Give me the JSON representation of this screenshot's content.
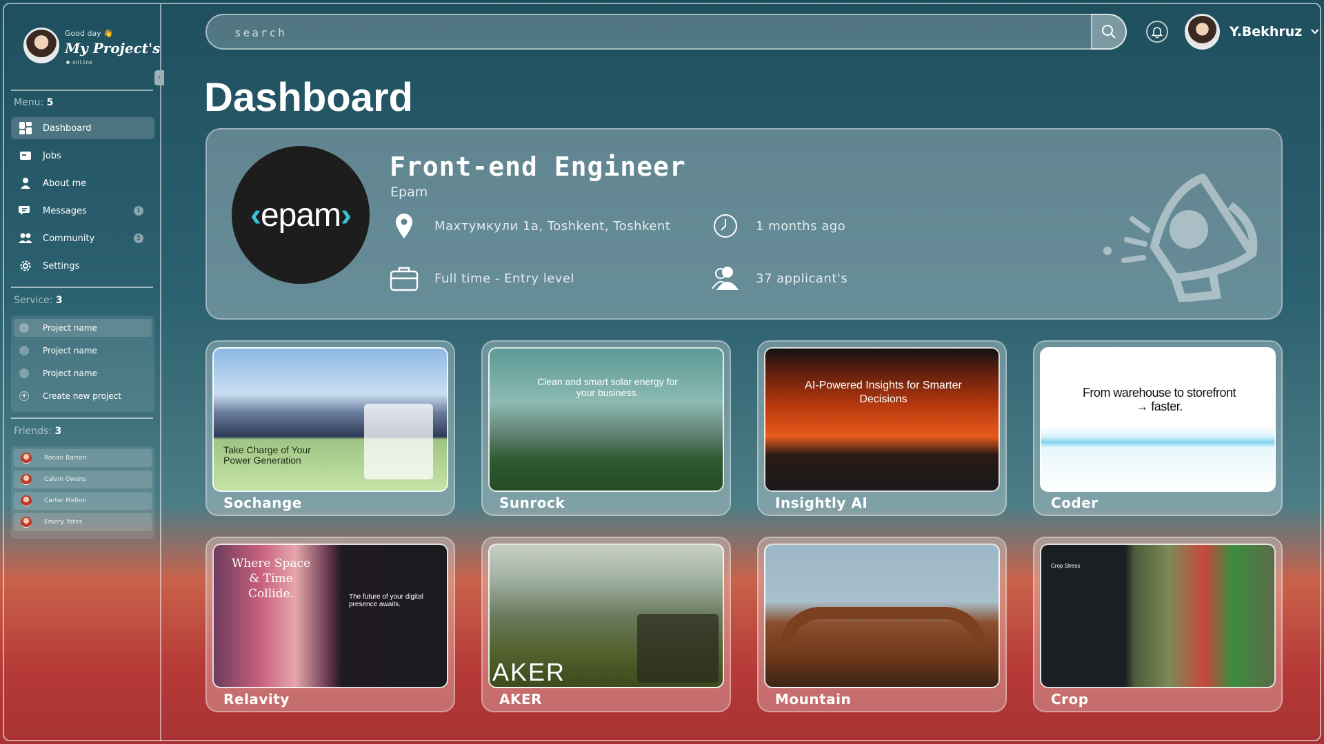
{
  "sidebar": {
    "greeting": "Good day 👋",
    "title": "My Project's",
    "status": "online",
    "menu_label": "Menu:",
    "menu_count": "5",
    "menu": [
      {
        "label": "Dashboard",
        "icon": "dashboard-icon"
      },
      {
        "label": "Jobs",
        "icon": "jobs-icon"
      },
      {
        "label": "About me",
        "icon": "user-icon"
      },
      {
        "label": "Messages",
        "icon": "messages-icon",
        "badge": "1"
      },
      {
        "label": "Community",
        "icon": "community-icon",
        "badge": "5"
      },
      {
        "label": "Settings",
        "icon": "gear-icon"
      }
    ],
    "service_label": "Service:",
    "service_count": "3",
    "services": [
      "Project name",
      "Project name",
      "Project name"
    ],
    "create_label": "Create new project",
    "friends_label": "Friends:",
    "friends_count": "3",
    "friends": [
      "Ronan Barton",
      "Calvin Owens",
      "Carter Melton",
      "Emery Yates"
    ]
  },
  "header": {
    "search_placeholder": "search",
    "username": "Y.Bekhruz"
  },
  "page_title": "Dashboard",
  "job": {
    "logo_text": "epam",
    "title": "Front-end Engineer",
    "company": "Epam",
    "location": "Махтумкули 1а, Toshkent, Toshkent",
    "posted": "1 months ago",
    "type": "Full time - Entry level",
    "applicants": "37 applicant's"
  },
  "projects": [
    {
      "name": "Sochange",
      "headline": "Take Charge of Your Power Generation"
    },
    {
      "name": "Sunrock",
      "headline": "Clean and smart solar energy for your business."
    },
    {
      "name": "Insightly AI",
      "headline": "AI-Powered Insights for Smarter Decisions"
    },
    {
      "name": "Coder",
      "headline": "From warehouse to storefront → faster."
    },
    {
      "name": "Relavity",
      "headline": "Where Space & Time Collide.",
      "sub": "The future of your digital presence awaits."
    },
    {
      "name": "AKER",
      "headline": "AKER"
    },
    {
      "name": "Mountain",
      "headline": ""
    },
    {
      "name": "Crop",
      "headline": "Crop Stress"
    }
  ],
  "colors": {
    "accent": "#39c2d7",
    "bg_top": "#1f4f5e",
    "bg_bottom": "#a83234"
  }
}
